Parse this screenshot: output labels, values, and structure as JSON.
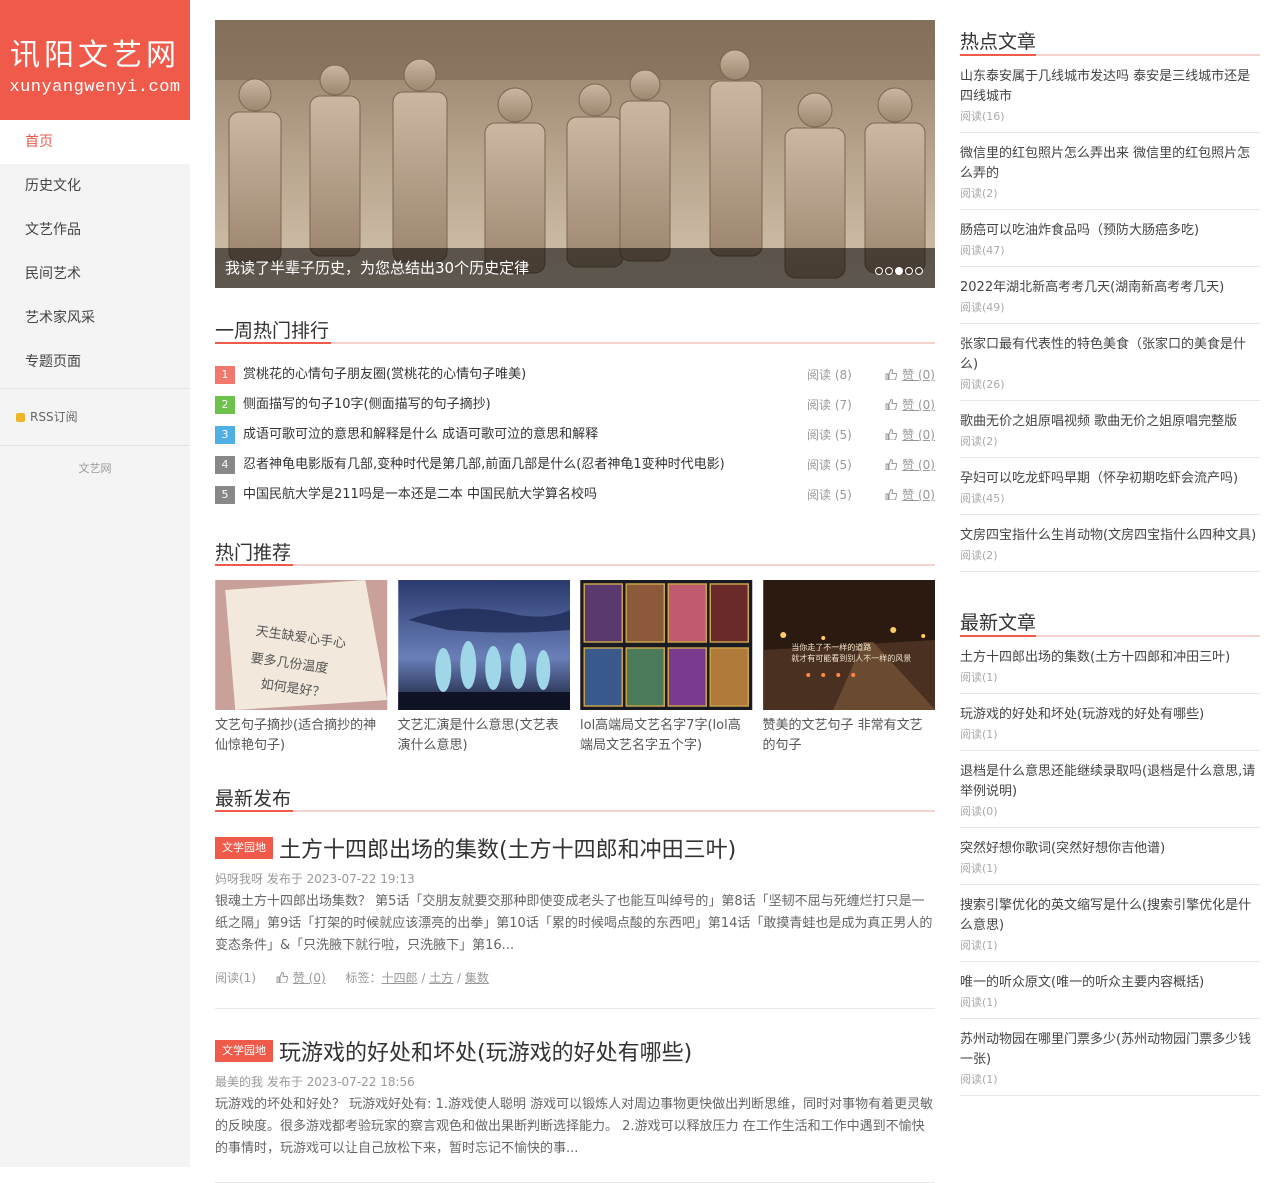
{
  "brand": {
    "name_cn": "讯阳文艺网",
    "name_en": "xunyangwenyi.com"
  },
  "nav": [
    {
      "label": "首页",
      "active": true
    },
    {
      "label": "历史文化"
    },
    {
      "label": "文艺作品"
    },
    {
      "label": "民间艺术"
    },
    {
      "label": "艺术家风采"
    },
    {
      "label": "专题页面"
    }
  ],
  "rss": {
    "label": "RSS订阅"
  },
  "sidebar_footer": "文艺网",
  "slider": {
    "caption": "我读了半辈子历史，为您总结出30个历史定律",
    "dot_count": 5,
    "active_index": 2
  },
  "weekly": {
    "title": "一周热门排行",
    "items": [
      {
        "num": "1",
        "color": "#f1786d",
        "title": "赏桃花的心情句子朋友圈(赏桃花的心情句子唯美)",
        "reads": "阅读 (8)",
        "likes": "赞 (0)"
      },
      {
        "num": "2",
        "color": "#6cc24a",
        "title": "侧面描写的句子10字(侧面描写的句子摘抄)",
        "reads": "阅读 (7)",
        "likes": "赞 (0)"
      },
      {
        "num": "3",
        "color": "#4fb0e6",
        "title": "成语可歌可泣的意思和解释是什么 成语可歌可泣的意思和解释",
        "reads": "阅读 (5)",
        "likes": "赞 (0)"
      },
      {
        "num": "4",
        "color": "#888888",
        "title": "忍者神龟电影版有几部,变种时代是第几部,前面几部是什么(忍者神龟1变种时代电影)",
        "reads": "阅读 (5)",
        "likes": "赞 (0)"
      },
      {
        "num": "5",
        "color": "#888888",
        "title": "中国民航大学是211吗是一本还是二本 中国民航大学算名校吗",
        "reads": "阅读 (5)",
        "likes": "赞 (0)"
      }
    ]
  },
  "recommend": {
    "title": "热门推荐",
    "items": [
      {
        "caption": "文艺句子摘抄(适合摘抄的神仙惊艳句子)",
        "img_text_1": "天生缺爱心手心",
        "img_text_2": "要多几份温度",
        "img_text_3": "如何是好？"
      },
      {
        "caption": "文艺汇演是什么意思(文艺表演什么意思)"
      },
      {
        "caption": "lol高端局文艺名字7字(lol高端局文艺名字五个字)"
      },
      {
        "caption": "赞美的文艺句子 非常有文艺的句子",
        "img_text_1": "当你走了不一样的道路",
        "img_text_2": "就才有可能看到别人不一样的风景"
      }
    ]
  },
  "latest": {
    "title": "最新发布",
    "posts": [
      {
        "category": "文学园地",
        "title": "土方十四郎出场的集数(土方十四郎和冲田三叶)",
        "author": "妈呀我呀",
        "published": "发布于 2023-07-22 19:13",
        "excerpt": "银魂土方十四郎出场集数？ 第5话「交朋友就要交那种即使变成老头了也能互叫绰号的」第8话「坚韧不屈与死缠烂打只是一纸之隔」第9话「打架的时候就应该漂亮的出拳」第10话「累的时候喝点酸的东西吧」第14话「敢摸青蛙也是成为真正男人的变态条件」&「只洗腋下就行啦，只洗腋下」第16...",
        "reads": "阅读(1)",
        "likes": "赞 (0)",
        "tags_label": "标签：",
        "tags": [
          "十四郎",
          "土方",
          "集数"
        ]
      },
      {
        "category": "文学园地",
        "title": "玩游戏的好处和坏处(玩游戏的好处有哪些)",
        "author": "最美的我",
        "published": "发布于 2023-07-22 18:56",
        "excerpt": "玩游戏的坏处和好处？ 玩游戏好处有: 1.游戏使人聪明 游戏可以锻炼人对周边事物更快做出判断思维，同时对事物有着更灵敏的反映度。很多游戏都考验玩家的察言观色和做出果断判断选择能力。 2.游戏可以释放压力 在工作生活和工作中遇到不愉快的事情时，玩游戏可以让自己放松下来，暂时忘记不愉快的事..."
      }
    ]
  },
  "hot_articles": {
    "title": "热点文章",
    "items": [
      {
        "title": "山东泰安属于几线城市发达吗 泰安是三线城市还是四线城市",
        "reads": "阅读(16)"
      },
      {
        "title": "微信里的红包照片怎么弄出来 微信里的红包照片怎么弄的",
        "reads": "阅读(2)"
      },
      {
        "title": "肠癌可以吃油炸食品吗（预防大肠癌多吃)",
        "reads": "阅读(47)"
      },
      {
        "title": "2022年湖北新高考考几天(湖南新高考考几天)",
        "reads": "阅读(49)"
      },
      {
        "title": "张家口最有代表性的特色美食（张家口的美食是什么)",
        "reads": "阅读(26)"
      },
      {
        "title": "歌曲无价之姐原唱视频 歌曲无价之姐原唱完整版",
        "reads": "阅读(2)"
      },
      {
        "title": "孕妇可以吃龙虾吗早期（怀孕初期吃虾会流产吗)",
        "reads": "阅读(45)"
      },
      {
        "title": "文房四宝指什么生肖动物(文房四宝指什么四种文具)",
        "reads": "阅读(2)"
      }
    ]
  },
  "new_articles": {
    "title": "最新文章",
    "items": [
      {
        "title": "土方十四郎出场的集数(土方十四郎和冲田三叶)",
        "reads": "阅读(1)"
      },
      {
        "title": "玩游戏的好处和坏处(玩游戏的好处有哪些)",
        "reads": "阅读(1)"
      },
      {
        "title": "退档是什么意思还能继续录取吗(退档是什么意思,请举例说明)",
        "reads": "阅读(0)"
      },
      {
        "title": "突然好想你歌词(突然好想你吉他谱)",
        "reads": "阅读(1)"
      },
      {
        "title": "搜索引擎优化的英文缩写是什么(搜索引擎优化是什么意思)",
        "reads": "阅读(1)"
      },
      {
        "title": "唯一的听众原文(唯一的听众主要内容概括)",
        "reads": "阅读(1)"
      },
      {
        "title": "苏州动物园在哪里门票多少(苏州动物园门票多少钱一张)",
        "reads": "阅读(1)"
      }
    ]
  }
}
